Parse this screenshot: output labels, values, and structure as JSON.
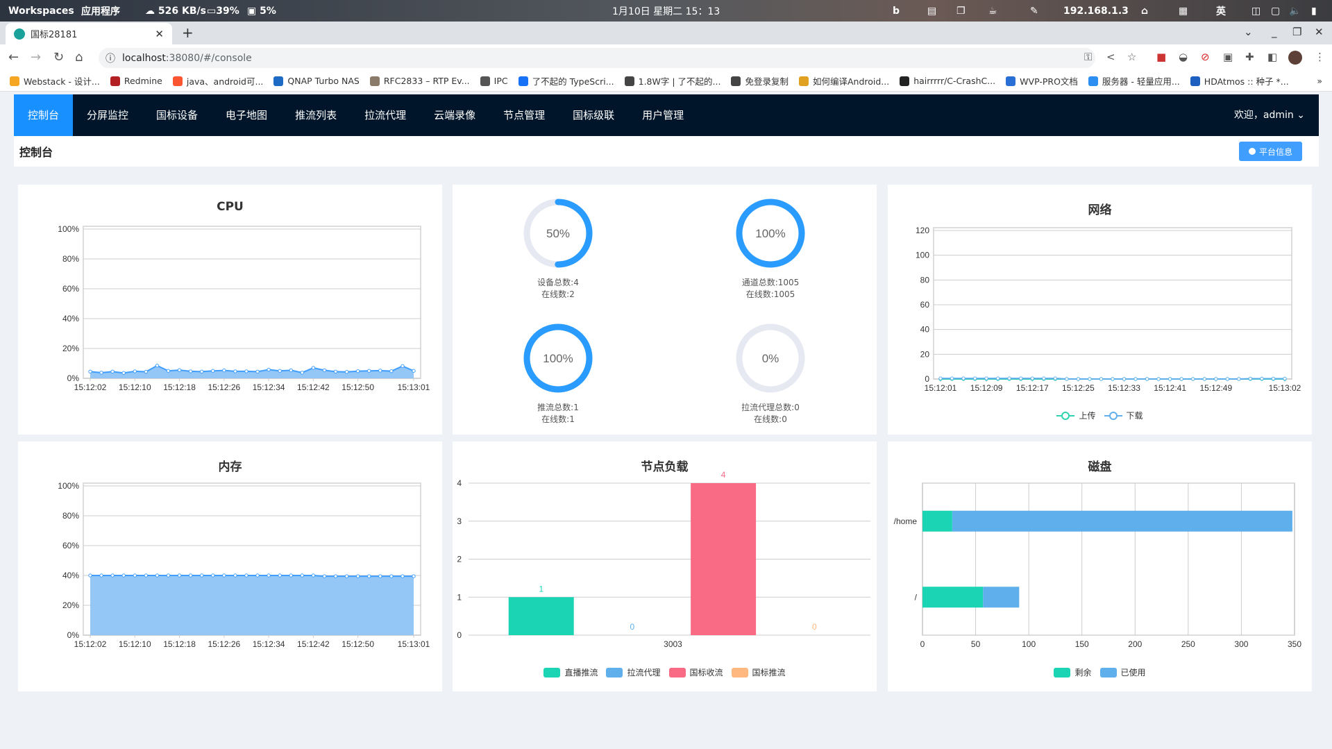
{
  "system_bar": {
    "workspaces": "Workspaces",
    "apps": "应用程序",
    "net_speed": "526 KB/s",
    "cpu": "39%",
    "mem": "5%",
    "datetime": "1月10日 星期二 15：13",
    "ip": "192.168.1.3",
    "ime": "英"
  },
  "browser": {
    "tab_title": "国标28181",
    "url_host": "localhost",
    "url_rest": ":38080/#/console",
    "bookmarks": [
      {
        "label": "Webstack - 设计...",
        "color": "#f5a623"
      },
      {
        "label": "Redmine",
        "color": "#b32024"
      },
      {
        "label": "java、android可...",
        "color": "#fc5531"
      },
      {
        "label": "QNAP Turbo NAS",
        "color": "#1e6bc6"
      },
      {
        "label": "RFC2833 – RTP Ev...",
        "color": "#8a7a6a"
      },
      {
        "label": "IPC",
        "color": "#555"
      },
      {
        "label": "了不起的 TypeScri...",
        "color": "#1772f6"
      },
      {
        "label": "1.8W字 | 了不起的...",
        "color": "#444"
      },
      {
        "label": "免登录复制",
        "color": "#444"
      },
      {
        "label": "如何编译Android...",
        "color": "#e0a020"
      },
      {
        "label": "hairrrrr/C-CrashC...",
        "color": "#222"
      },
      {
        "label": "WVP-PRO文档",
        "color": "#2a6fd6"
      },
      {
        "label": "服务器 - 轻量应用...",
        "color": "#2b8ef0"
      },
      {
        "label": "HDAtmos :: 种子 *...",
        "color": "#1d5fc0"
      }
    ]
  },
  "nav": {
    "items": [
      "控制台",
      "分屏监控",
      "国标设备",
      "电子地图",
      "推流列表",
      "拉流代理",
      "云端录像",
      "节点管理",
      "国标级联",
      "用户管理"
    ],
    "active": 0,
    "user": "欢迎，admin"
  },
  "header": {
    "title": "控制台",
    "info_button": "平台信息"
  },
  "colors": {
    "accent": "#1890ff",
    "nav_bg": "#001529",
    "line": "#409eff",
    "area": "#8ec3f6",
    "green": "#1bd4b4",
    "blue": "#5eafec",
    "red": "#f96b85",
    "orange": "#ffb980",
    "ring_bg": "#e6e9f2"
  },
  "gauges": [
    {
      "percent": 50,
      "label": "50%",
      "line1": "设备总数:4",
      "line2": "在线数:2"
    },
    {
      "percent": 100,
      "label": "100%",
      "line1": "通道总数:1005",
      "line2": "在线数:1005"
    },
    {
      "percent": 100,
      "label": "100%",
      "line1": "推流总数:1",
      "line2": "在线数:1"
    },
    {
      "percent": 0,
      "label": "0%",
      "line1": "拉流代理总数:0",
      "line2": "在线数:0"
    }
  ],
  "chart_data": [
    {
      "id": "cpu",
      "type": "area",
      "title": "CPU",
      "ylim": [
        0,
        100
      ],
      "yticks": [
        "0%",
        "20%",
        "40%",
        "60%",
        "80%",
        "100%"
      ],
      "x": [
        "15:12:02",
        "15:12:04",
        "15:12:06",
        "15:12:08",
        "15:12:10",
        "15:12:12",
        "15:12:14",
        "15:12:16",
        "15:12:18",
        "15:12:20",
        "15:12:22",
        "15:12:24",
        "15:12:26",
        "15:12:28",
        "15:12:30",
        "15:12:32",
        "15:12:34",
        "15:12:36",
        "15:12:38",
        "15:12:40",
        "15:12:42",
        "15:12:44",
        "15:12:46",
        "15:12:48",
        "15:12:50",
        "15:12:52",
        "15:12:54",
        "15:12:56",
        "15:12:58",
        "15:13:01"
      ],
      "xtick_labels": [
        "15:12:02",
        "15:12:10",
        "15:12:18",
        "15:12:26",
        "15:12:34",
        "15:12:42",
        "15:12:50",
        "15:13:01"
      ],
      "values": [
        4.5,
        3.8,
        4.5,
        3.6,
        4.7,
        4.4,
        8.5,
        5,
        5.5,
        4.7,
        4.5,
        5,
        5.3,
        4.7,
        4.7,
        4.5,
        5.8,
        5,
        5.4,
        3.8,
        7,
        5.4,
        4.5,
        4.3,
        4.8,
        5,
        5.2,
        4.8,
        8.2,
        5
      ]
    },
    {
      "id": "net",
      "type": "line",
      "title": "网络",
      "ylim": [
        0,
        120
      ],
      "yticks": [
        "0",
        "20",
        "40",
        "60",
        "80",
        "100",
        "120"
      ],
      "x": [
        "15:12:01",
        "15:12:03",
        "15:12:05",
        "15:12:07",
        "15:12:09",
        "15:12:11",
        "15:12:13",
        "15:12:15",
        "15:12:17",
        "15:12:19",
        "15:12:21",
        "15:12:23",
        "15:12:25",
        "15:12:27",
        "15:12:29",
        "15:12:31",
        "15:12:33",
        "15:12:35",
        "15:12:37",
        "15:12:39",
        "15:12:41",
        "15:12:43",
        "15:12:45",
        "15:12:47",
        "15:12:49",
        "15:12:51",
        "15:12:53",
        "15:12:55",
        "15:12:57",
        "15:12:59",
        "15:13:02"
      ],
      "xtick_labels": [
        "15:12:01",
        "15:12:09",
        "15:12:17",
        "15:12:25",
        "15:12:33",
        "15:12:41",
        "15:12:49",
        "15:13:02"
      ],
      "series": [
        {
          "name": "上传",
          "color": "#2ed3b0",
          "values": [
            0,
            0,
            0,
            0,
            0,
            0,
            0,
            0,
            0,
            0,
            0,
            0,
            0,
            0,
            0,
            0,
            0,
            0,
            0,
            0,
            0,
            0,
            0,
            0,
            0,
            0,
            0,
            0,
            0,
            0,
            0
          ]
        },
        {
          "name": "下载",
          "color": "#5eafec",
          "values": [
            0.5,
            0.5,
            0.5,
            0.5,
            0.5,
            0.5,
            0.5,
            0.5,
            0.5,
            0.5,
            0.5,
            0,
            0,
            0,
            0,
            0,
            0,
            0,
            0,
            0,
            0,
            0,
            0,
            0,
            0,
            0,
            0,
            0.3,
            0.3,
            0.3,
            0.3
          ]
        }
      ]
    },
    {
      "id": "mem",
      "type": "area",
      "title": "内存",
      "ylim": [
        0,
        100
      ],
      "yticks": [
        "0%",
        "20%",
        "40%",
        "60%",
        "80%",
        "100%"
      ],
      "x": [
        "15:12:02",
        "15:12:04",
        "15:12:06",
        "15:12:08",
        "15:12:10",
        "15:12:12",
        "15:12:14",
        "15:12:16",
        "15:12:18",
        "15:12:20",
        "15:12:22",
        "15:12:24",
        "15:12:26",
        "15:12:28",
        "15:12:30",
        "15:12:32",
        "15:12:34",
        "15:12:36",
        "15:12:38",
        "15:12:40",
        "15:12:42",
        "15:12:44",
        "15:12:46",
        "15:12:48",
        "15:12:50",
        "15:12:52",
        "15:12:54",
        "15:12:56",
        "15:12:58",
        "15:13:01"
      ],
      "xtick_labels": [
        "15:12:02",
        "15:12:10",
        "15:12:18",
        "15:12:26",
        "15:12:34",
        "15:12:42",
        "15:12:50",
        "15:13:01"
      ],
      "values": [
        40,
        40,
        40,
        40,
        40,
        40,
        40,
        40,
        40,
        40,
        40,
        40,
        40,
        40,
        40,
        40,
        40,
        40,
        40,
        40,
        40,
        39.5,
        39.5,
        39.5,
        39.5,
        39.5,
        39.5,
        39.5,
        39.5,
        39.5
      ]
    },
    {
      "id": "node",
      "type": "bar",
      "title": "节点负载",
      "categories": [
        "3003"
      ],
      "ylim": [
        0,
        4
      ],
      "yticks": [
        "0",
        "1",
        "2",
        "3",
        "4"
      ],
      "series": [
        {
          "name": "直播推流",
          "color": "#1bd4b4",
          "values": [
            1
          ]
        },
        {
          "name": "拉流代理",
          "color": "#5eafec",
          "values": [
            0
          ]
        },
        {
          "name": "国标收流",
          "color": "#f96b85",
          "values": [
            4
          ]
        },
        {
          "name": "国标推流",
          "color": "#ffb980",
          "values": [
            0
          ]
        }
      ]
    },
    {
      "id": "disk",
      "type": "bar-horizontal-stacked",
      "title": "磁盘",
      "categories": [
        "/home",
        "/"
      ],
      "xlim": [
        0,
        350
      ],
      "xticks": [
        "0",
        "50",
        "100",
        "150",
        "200",
        "250",
        "300",
        "350"
      ],
      "series": [
        {
          "name": "剩余",
          "color": "#1bd4b4",
          "values": [
            28,
            57
          ]
        },
        {
          "name": "已使用",
          "color": "#5eafec",
          "values": [
            320,
            34
          ]
        }
      ]
    }
  ]
}
